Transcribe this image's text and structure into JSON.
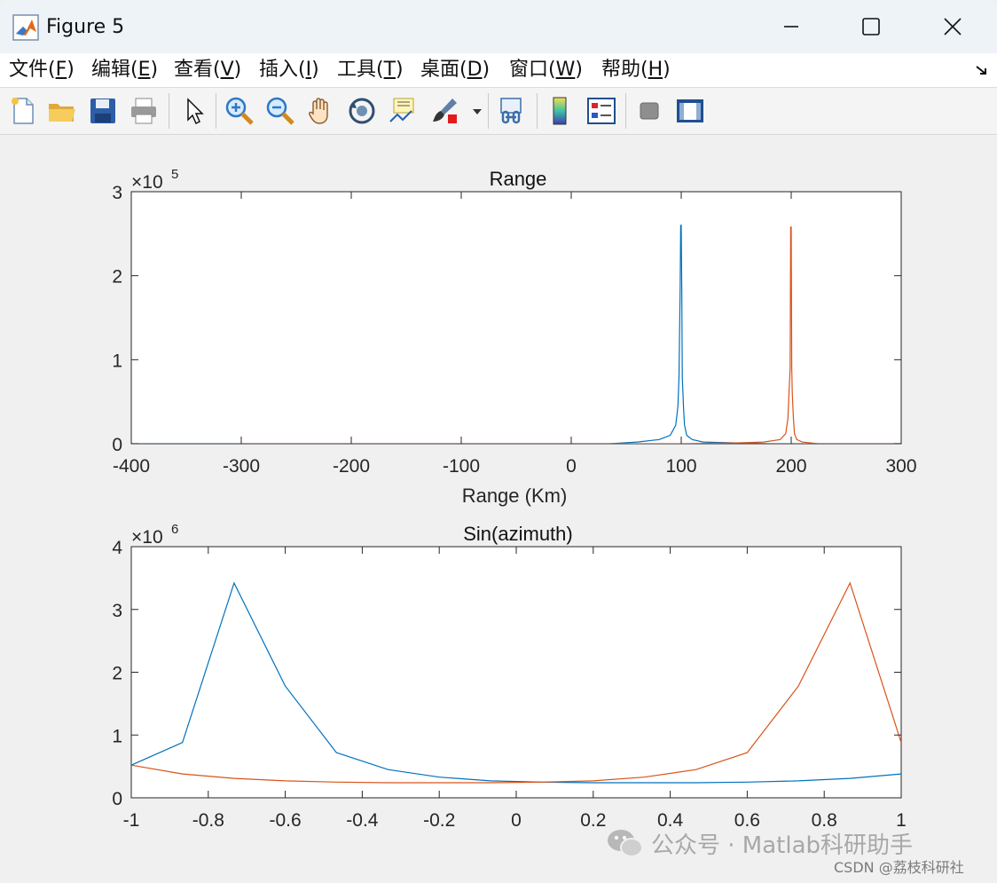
{
  "window": {
    "title": "Figure 5"
  },
  "menu": [
    {
      "pre": "文件(",
      "key": "F",
      "post": ")"
    },
    {
      "pre": "编辑(",
      "key": "E",
      "post": ")"
    },
    {
      "pre": "查看(",
      "key": "V",
      "post": ")"
    },
    {
      "pre": "插入(",
      "key": "I",
      "post": ")"
    },
    {
      "pre": "工具(",
      "key": "T",
      "post": ")"
    },
    {
      "pre": "桌面(",
      "key": "D",
      "post": ")"
    },
    {
      "pre": "窗口(",
      "key": "W",
      "post": ")"
    },
    {
      "pre": "帮助(",
      "key": "H",
      "post": ")"
    }
  ],
  "toolbar": {
    "icons": [
      "new-figure-icon",
      "open-file-icon",
      "save-icon",
      "print-icon",
      "pointer-icon",
      "zoom-in-icon",
      "zoom-out-icon",
      "pan-hand-icon",
      "rotate-3d-icon",
      "data-cursor-icon",
      "brush-icon",
      "link-plot-icon",
      "colorbar-icon",
      "legend-icon",
      "hide-plot-tools-icon",
      "show-plot-tools-icon"
    ]
  },
  "chart_data": [
    {
      "type": "line",
      "title": "Range",
      "xlabel": "Range (Km)",
      "ylabel": "",
      "exponent_label": "×10",
      "exponent": "5",
      "xlim": [
        -400,
        300
      ],
      "ylim": [
        0,
        3
      ],
      "xticks": [
        -400,
        -300,
        -200,
        -100,
        0,
        100,
        200,
        300
      ],
      "yticks": [
        0,
        1,
        2,
        3
      ],
      "xtick_labels": [
        "-400",
        "-300",
        "-200",
        "-100",
        "0",
        "100",
        "200",
        "300"
      ],
      "ytick_labels": [
        "0",
        "1",
        "2",
        "3"
      ],
      "series": [
        {
          "color": "#0072bd",
          "x": [
            -400,
            35,
            60,
            80,
            90,
            95,
            97,
            98,
            99,
            99.5,
            100,
            100.5,
            101,
            102,
            103,
            105,
            110,
            120,
            150,
            180,
            200,
            225,
            300
          ],
          "y": [
            0,
            0,
            0.02,
            0.05,
            0.1,
            0.22,
            0.45,
            0.8,
            1.85,
            2.6,
            2.6,
            1.85,
            0.8,
            0.45,
            0.22,
            0.1,
            0.05,
            0.02,
            0.01,
            0,
            0,
            0,
            0
          ]
        },
        {
          "color": "#d95319",
          "x": [
            -300,
            100,
            150,
            175,
            190,
            195,
            197,
            198,
            199,
            199.5,
            200,
            200.5,
            201,
            202,
            203,
            205,
            210,
            225,
            300
          ],
          "y": [
            0,
            0,
            0.01,
            0.02,
            0.05,
            0.12,
            0.3,
            0.6,
            0.9,
            2.58,
            2.58,
            0.9,
            0.6,
            0.3,
            0.12,
            0.05,
            0.02,
            0,
            0
          ]
        }
      ]
    },
    {
      "type": "line",
      "title": "Sin(azimuth)",
      "xlabel": "",
      "ylabel": "",
      "exponent_label": "×10",
      "exponent": "6",
      "xlim": [
        -1,
        1
      ],
      "ylim": [
        0,
        4
      ],
      "xticks": [
        -1,
        -0.8,
        -0.6,
        -0.4,
        -0.2,
        0,
        0.2,
        0.4,
        0.6,
        0.8,
        1
      ],
      "yticks": [
        0,
        1,
        2,
        3,
        4
      ],
      "xtick_labels": [
        "-1",
        "-0.8",
        "-0.6",
        "-0.4",
        "-0.2",
        "0",
        "0.2",
        "0.4",
        "0.6",
        "0.8",
        "1"
      ],
      "ytick_labels": [
        "0",
        "1",
        "2",
        "3",
        "4"
      ],
      "series": [
        {
          "color": "#0072bd",
          "x": [
            -1,
            -0.867,
            -0.733,
            -0.6,
            -0.467,
            -0.333,
            -0.2,
            -0.067,
            0.067,
            0.2,
            0.333,
            0.467,
            0.6,
            0.733,
            0.867,
            1
          ],
          "y": [
            0.52,
            0.88,
            3.42,
            1.78,
            0.72,
            0.45,
            0.33,
            0.27,
            0.25,
            0.24,
            0.24,
            0.24,
            0.25,
            0.27,
            0.31,
            0.38
          ]
        },
        {
          "color": "#d95319",
          "x": [
            -1,
            -0.867,
            -0.733,
            -0.6,
            -0.467,
            -0.333,
            -0.2,
            -0.067,
            0.067,
            0.2,
            0.333,
            0.467,
            0.6,
            0.733,
            0.867,
            1
          ],
          "y": [
            0.52,
            0.38,
            0.31,
            0.27,
            0.25,
            0.24,
            0.24,
            0.24,
            0.25,
            0.27,
            0.33,
            0.45,
            0.72,
            1.78,
            3.42,
            0.88
          ]
        }
      ]
    }
  ],
  "watermark": {
    "text": "公众号 · Matlab科研助手",
    "csdn": "CSDN @荔枝科研社"
  }
}
